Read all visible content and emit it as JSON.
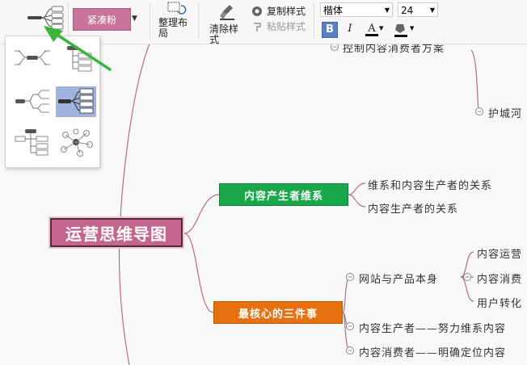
{
  "toolbar": {
    "style_label": "紧凑粉",
    "arrange_line1": "整理布",
    "arrange_line2": "局",
    "clear_label": "清除样",
    "clear_line2": "式",
    "copy_style_label": "复制样式",
    "paste_style_label": "粘贴样式",
    "font_name": "楷体",
    "font_size": "24",
    "bold_label": "B",
    "italic_label": "I",
    "font_color_label": "A"
  },
  "colors": {
    "accent_pink": "#c3658d",
    "green": "#18a84a",
    "orange": "#e8710f",
    "annotation_arrow": "#3cb53c",
    "selected_layout": "#9fb3dc",
    "connector": "#b86b86"
  },
  "mindmap": {
    "root": "运营思维导图",
    "top_partial": "控制内容消费者方案",
    "moat": "护城河",
    "producer_node": "内容产生者维系",
    "producer_child_1": "维系和内容生产者的关系",
    "producer_child_2": "内容生产者的关系",
    "three_node": "最核心的三件事",
    "site_product": "网站与产品本身",
    "site_child_1": "内容运营",
    "site_child_2": "内容消费",
    "site_child_3": "用户转化",
    "producer_effort": "内容生产者——努力维系内容",
    "consumer_position": "内容消费者——明确定位内容"
  },
  "icons": [
    "layout-map-icon",
    "arrange-layout-icon",
    "brush-icon",
    "copy-style-icon",
    "paste-style-icon",
    "fill-color-icon",
    "collapse-icon"
  ]
}
